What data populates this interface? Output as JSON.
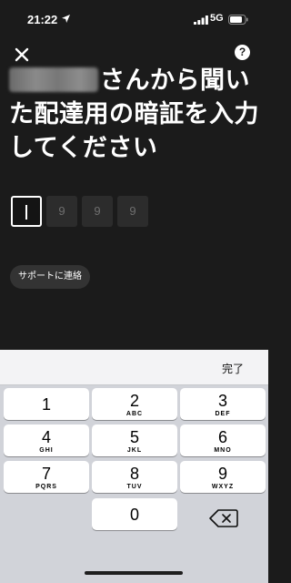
{
  "status_bar": {
    "time": "21:22",
    "network": "5G",
    "location_icon": "location-arrow-icon",
    "signal_icon": "cellular-signal-icon",
    "battery_icon": "battery-icon"
  },
  "header": {
    "close_icon": "close-icon",
    "help_icon": "help-icon",
    "help_glyph": "?"
  },
  "heading": {
    "line1_suffix": "さんから聞い",
    "line2": "た配達用の暗証を入力",
    "line3": "してください"
  },
  "code_input": {
    "digits": [
      "",
      "9",
      "9",
      "9"
    ]
  },
  "support_button": {
    "label": "サポートに連絡"
  },
  "keyboard": {
    "done_label": "完了",
    "keys": [
      {
        "digit": "1",
        "letters": ""
      },
      {
        "digit": "2",
        "letters": "ABC"
      },
      {
        "digit": "3",
        "letters": "DEF"
      },
      {
        "digit": "4",
        "letters": "GHI"
      },
      {
        "digit": "5",
        "letters": "JKL"
      },
      {
        "digit": "6",
        "letters": "MNO"
      },
      {
        "digit": "7",
        "letters": "PQRS"
      },
      {
        "digit": "8",
        "letters": "TUV"
      },
      {
        "digit": "9",
        "letters": "WXYZ"
      },
      {
        "digit": "0",
        "letters": ""
      }
    ],
    "backspace_icon": "backspace-icon"
  },
  "colors": {
    "background": "#1b1b1b",
    "keyboard": "#d1d3d9",
    "key": "#ffffff"
  }
}
